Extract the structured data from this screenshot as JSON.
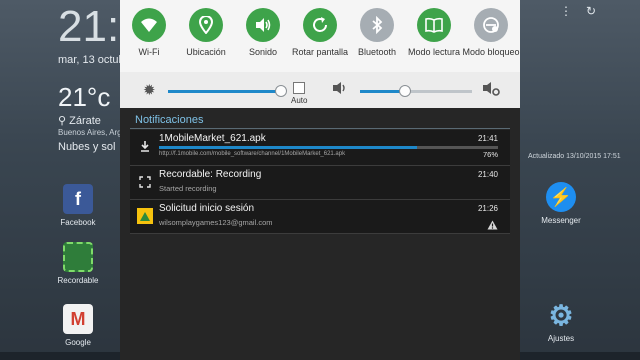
{
  "home": {
    "clock": "21:",
    "date": "mar, 13 octub",
    "temp": "21°c",
    "location": "Zárate",
    "city": "Buenos Aires, Arge",
    "weather": "Nubes y sol",
    "updated": "Actualizado 13/10/2015 17:51",
    "apps": [
      {
        "label": "Facebook"
      },
      {
        "label": "Recordable"
      },
      {
        "label": "Google"
      },
      {
        "label": "Messenger"
      },
      {
        "label": "Ajustes"
      }
    ]
  },
  "quick_settings": {
    "tiles": [
      {
        "label": "Wi-Fi",
        "on": true,
        "icon": "wifi-icon"
      },
      {
        "label": "Ubicación",
        "on": true,
        "icon": "location-icon"
      },
      {
        "label": "Sonido",
        "on": true,
        "icon": "sound-icon"
      },
      {
        "label": "Rotar pantalla",
        "on": true,
        "icon": "rotate-icon"
      },
      {
        "label": "Bluetooth",
        "on": false,
        "icon": "bluetooth-icon"
      },
      {
        "label": "Modo lectura",
        "on": true,
        "icon": "book-icon"
      },
      {
        "label": "Modo bloqueo",
        "on": false,
        "icon": "block-mode-icon"
      }
    ],
    "colors": {
      "on": "#3ea34a",
      "off": "#a6adb3",
      "accent": "#1e88c9"
    }
  },
  "sliders": {
    "brightness_level": 1.0,
    "auto_label": "Auto",
    "volume_level": 0.4
  },
  "notifications": {
    "header": "Notificaciones",
    "items": [
      {
        "title": "1MobileMarket_621.apk",
        "subtitle": "http://f.1mobile.com/mobile_software/channel/1MobileMarket_621.apk",
        "time": "21:41",
        "progress_text": "76%",
        "progress": 0.76,
        "icon": "download-icon"
      },
      {
        "title": "Recordable: Recording",
        "subtitle": "Started recording",
        "time": "21:40",
        "icon": "screen-record-icon"
      },
      {
        "title": "Solicitud inicio sesión",
        "subtitle": "wilsomplaygames123@gmail.com",
        "time": "21:26",
        "icon": "google-signin-icon",
        "badge_icon": "warning-icon"
      }
    ]
  }
}
